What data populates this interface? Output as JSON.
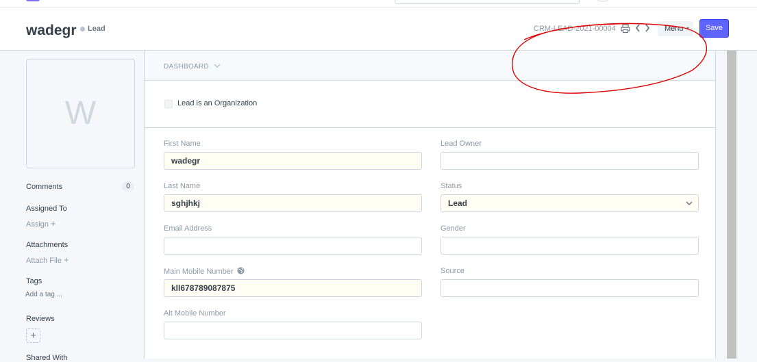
{
  "header": {
    "title": "wadegr",
    "status": "Lead",
    "doc_name": "CRM-LEAD-2021-00004",
    "menu_label": "Menu",
    "save_label": "Save"
  },
  "sidebar": {
    "avatar_letter": "W",
    "comments_label": "Comments",
    "comments_count": "0",
    "assigned_to_label": "Assigned To",
    "assign_link": "Assign",
    "attachments_label": "Attachments",
    "attach_link": "Attach File",
    "tags_label": "Tags",
    "add_tag_link": "Add a tag ...",
    "reviews_label": "Reviews",
    "shared_with_label": "Shared With"
  },
  "form": {
    "dashboard_label": "DASHBOARD",
    "org_checkbox_label": "Lead is an Organization",
    "first_name_label": "First Name",
    "first_name_value": "wadegr",
    "lead_owner_label": "Lead Owner",
    "lead_owner_value": "",
    "last_name_label": "Last Name",
    "last_name_value": "sghjhkj",
    "status_label": "Status",
    "status_value": "Lead",
    "email_label": "Email Address",
    "email_value": "",
    "gender_label": "Gender",
    "gender_value": "",
    "mobile_label": "Main Mobile Number",
    "mobile_value": "kll678789087875",
    "source_label": "Source",
    "source_value": "",
    "alt_mobile_label": "Alt Mobile Number",
    "alt_mobile_value": ""
  },
  "icons": {
    "print": "printer-icon",
    "prev": "chevron-left-icon",
    "next": "chevron-right-icon",
    "globe": "globe-icon"
  },
  "colors": {
    "primary": "#5e64ff",
    "annotation": "#e00000",
    "filled_field_bg": "#fffdf4"
  }
}
